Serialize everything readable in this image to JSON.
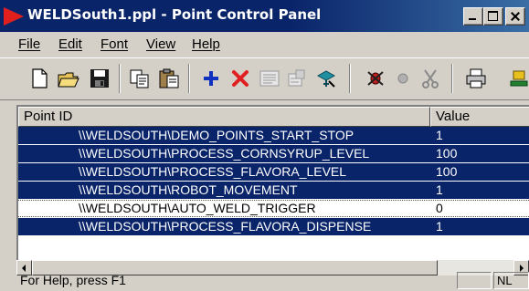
{
  "window": {
    "title": "WELDSouth1.ppl - Point Control Panel"
  },
  "menu": {
    "items": [
      "File",
      "Edit",
      "Font",
      "View",
      "Help"
    ]
  },
  "toolbar": {
    "icons": [
      "new-file-icon",
      "open-folder-icon",
      "save-icon",
      "copy-icon",
      "paste-icon",
      "add-icon",
      "delete-icon",
      "properties-icon",
      "configure-icon",
      "connect-icon",
      "stop-bug-icon",
      "record-icon",
      "cut-icon",
      "print-icon",
      "network-icon"
    ]
  },
  "list": {
    "columns": [
      "Point ID",
      "Value"
    ],
    "rows": [
      {
        "point_id": "\\\\WELDSOUTH\\DEMO_POINTS_START_STOP",
        "value": "1",
        "selected": true
      },
      {
        "point_id": "\\\\WELDSOUTH\\PROCESS_CORNSYRUP_LEVEL",
        "value": "100",
        "selected": true
      },
      {
        "point_id": "\\\\WELDSOUTH\\PROCESS_FLAVORA_LEVEL",
        "value": "100",
        "selected": true
      },
      {
        "point_id": "\\\\WELDSOUTH\\ROBOT_MOVEMENT",
        "value": "1",
        "selected": true
      },
      {
        "point_id": "\\\\WELDSOUTH\\AUTO_WELD_TRIGGER",
        "value": "0",
        "selected": false
      },
      {
        "point_id": "\\\\WELDSOUTH\\PROCESS_FLAVORA_DISPENSE",
        "value": "1",
        "selected": true
      }
    ]
  },
  "status": {
    "text": "For Help, press F1",
    "pane1": "",
    "pane2": "NL"
  },
  "colors": {
    "title_bar": "#0a246a",
    "selection": "#0a246a",
    "chrome": "#d4d0c8"
  }
}
